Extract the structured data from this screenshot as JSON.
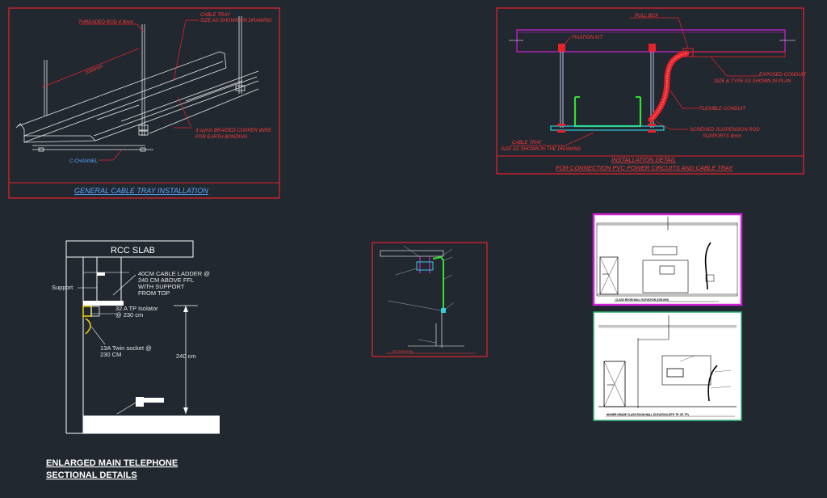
{
  "panel1": {
    "title": "GENERAL CABLE TRAY INSTALLATION",
    "threaded_rod": "THREADED ROD 4 8mm",
    "cable_tray_1": "CABLE TRAY",
    "cable_tray_2": "SIZE AS SHOWN ON DRAWING",
    "length": "1000mm",
    "copper_1": "3 sqmm BRAIDED COPPER WIRE",
    "copper_2": "FOR EARTH BONDING",
    "channel": "C-CHANNEL"
  },
  "panel2": {
    "title_1": "INSTALLATION DETAIL",
    "title_2": "FOR CONNECTION PVC POWER CIRCUITS AND CABLE TRAY",
    "pull_box": "PULL BOX",
    "fixation_kit": "FIXATION KIT",
    "exposed_1": "EXPOSED CONDUIT",
    "exposed_2": "SIZE & TYPE AS SHOWN IN PLAN",
    "flexible": "FLEXIBLE CONDUIT",
    "screwed_1": "SCREWED SUSPENSION ROD",
    "screwed_2": "SUPPORTS 8mm",
    "tray_1": "CABLE TRAY",
    "tray_2": "SIZE AS SHOWN IN THE DRAWING"
  },
  "panel3": {
    "slab": "RCC SLAB",
    "ladder_1": "40CM CABLE LADDER @",
    "ladder_2": "240 CM ABOVE FFL",
    "ladder_3": "WITH SUPPORT",
    "ladder_4": "FROM TOP",
    "support": "Support",
    "isolator_1": "32 A TP Isolator",
    "isolator_2": "@ 230 cm",
    "socket_1": "13A Twin socket @",
    "socket_2": "230 CM",
    "height": "240 cm",
    "caption_1": "ENLARGED MAIN TELEPHONE",
    "caption_2": "SECTIONAL DETAILS"
  },
  "panel4": {
    "caption": "SECTION DETAIL"
  },
  "panel5": {
    "caption": "CLASS ROOM WALL ELEVATION (CEILING)",
    "door": "DOOR"
  },
  "panel6": {
    "caption": "HIGHER GRADE CLASS ROOM WALL ELEVATION (ETP, TP, CP, TP)",
    "door": "DOOR"
  },
  "colors": {
    "background": "#212830",
    "frame_red": "#e8222a",
    "cad_magenta": "#d020d8",
    "cad_green": "#33e033",
    "cad_cyan": "#2fd0e0",
    "cad_blue": "#5aa7ff"
  }
}
